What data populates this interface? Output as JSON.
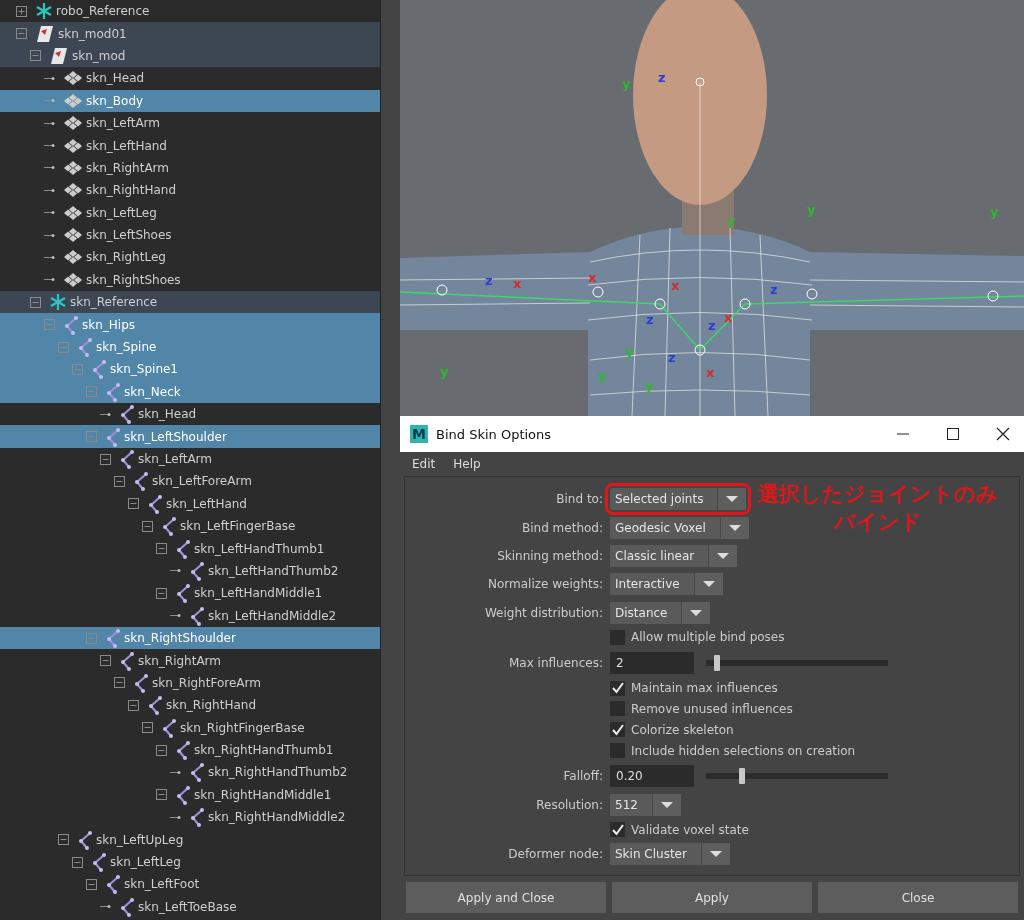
{
  "outliner": {
    "items": [
      {
        "label": "robo_Reference",
        "kind": "reference",
        "selected": false,
        "highlighted": false,
        "expanded": false
      },
      {
        "label": "skn_mod01",
        "kind": "group",
        "selected": false,
        "highlighted": true,
        "expanded": true,
        "children": [
          {
            "label": "skn_mod",
            "kind": "group",
            "selected": false,
            "highlighted": true,
            "expanded": true,
            "children": [
              {
                "label": "skn_Head",
                "kind": "mesh",
                "selected": false,
                "highlighted": false
              },
              {
                "label": "skn_Body",
                "kind": "mesh",
                "selected": true
              },
              {
                "label": "skn_LeftArm",
                "kind": "mesh",
                "selected": false,
                "highlighted": false
              },
              {
                "label": "skn_LeftHand",
                "kind": "mesh",
                "selected": false,
                "highlighted": false
              },
              {
                "label": "skn_RightArm",
                "kind": "mesh",
                "selected": false,
                "highlighted": false
              },
              {
                "label": "skn_RightHand",
                "kind": "mesh",
                "selected": false,
                "highlighted": false
              },
              {
                "label": "skn_LeftLeg",
                "kind": "mesh",
                "selected": false,
                "highlighted": false
              },
              {
                "label": "skn_LeftShoes",
                "kind": "mesh",
                "selected": false,
                "highlighted": false
              },
              {
                "label": "skn_RightLeg",
                "kind": "mesh",
                "selected": false,
                "highlighted": false
              },
              {
                "label": "skn_RightShoes",
                "kind": "mesh",
                "selected": false,
                "highlighted": false
              }
            ]
          },
          {
            "label": "skn_Reference",
            "kind": "reference",
            "selected": false,
            "highlighted": true,
            "expanded": true,
            "children": [
              {
                "label": "skn_Hips",
                "kind": "joint",
                "selected": true,
                "expanded": true,
                "children": [
                  {
                    "label": "skn_Spine",
                    "kind": "joint",
                    "selected": true,
                    "expanded": true,
                    "children": [
                      {
                        "label": "skn_Spine1",
                        "kind": "joint",
                        "selected": true,
                        "expanded": true,
                        "children": [
                          {
                            "label": "skn_Neck",
                            "kind": "joint",
                            "selected": true,
                            "expanded": true,
                            "children": [
                              {
                                "label": "skn_Head",
                                "kind": "joint",
                                "selected": false,
                                "highlighted": false
                              }
                            ]
                          },
                          {
                            "label": "skn_LeftShoulder",
                            "kind": "joint",
                            "selected": true,
                            "expanded": true,
                            "children": [
                              {
                                "label": "skn_LeftArm",
                                "kind": "joint",
                                "selected": false,
                                "highlighted": false,
                                "expanded": true,
                                "children": [
                                  {
                                    "label": "skn_LeftForeArm",
                                    "kind": "joint",
                                    "selected": false,
                                    "highlighted": false,
                                    "expanded": true,
                                    "children": [
                                      {
                                        "label": "skn_LeftHand",
                                        "kind": "joint",
                                        "selected": false,
                                        "highlighted": false,
                                        "expanded": true,
                                        "children": [
                                          {
                                            "label": "skn_LeftFingerBase",
                                            "kind": "joint",
                                            "selected": false,
                                            "highlighted": false,
                                            "expanded": true,
                                            "children": [
                                              {
                                                "label": "skn_LeftHandThumb1",
                                                "kind": "joint",
                                                "selected": false,
                                                "highlighted": false,
                                                "expanded": true,
                                                "children": [
                                                  {
                                                    "label": "skn_LeftHandThumb2",
                                                    "kind": "joint",
                                                    "selected": false,
                                                    "highlighted": false
                                                  }
                                                ]
                                              },
                                              {
                                                "label": "skn_LeftHandMiddle1",
                                                "kind": "joint",
                                                "selected": false,
                                                "highlighted": false,
                                                "expanded": true,
                                                "children": [
                                                  {
                                                    "label": "skn_LeftHandMiddle2",
                                                    "kind": "joint",
                                                    "selected": false,
                                                    "highlighted": false
                                                  }
                                                ]
                                              }
                                            ]
                                          }
                                        ]
                                      }
                                    ]
                                  }
                                ]
                              }
                            ]
                          },
                          {
                            "label": "skn_RightShoulder",
                            "kind": "joint",
                            "selected": true,
                            "expanded": true,
                            "children": [
                              {
                                "label": "skn_RightArm",
                                "kind": "joint",
                                "selected": false,
                                "highlighted": false,
                                "expanded": true,
                                "children": [
                                  {
                                    "label": "skn_RightForeArm",
                                    "kind": "joint",
                                    "selected": false,
                                    "highlighted": false,
                                    "expanded": true,
                                    "children": [
                                      {
                                        "label": "skn_RightHand",
                                        "kind": "joint",
                                        "selected": false,
                                        "highlighted": false,
                                        "expanded": true,
                                        "children": [
                                          {
                                            "label": "skn_RightFingerBase",
                                            "kind": "joint",
                                            "selected": false,
                                            "highlighted": false,
                                            "expanded": true,
                                            "children": [
                                              {
                                                "label": "skn_RightHandThumb1",
                                                "kind": "joint",
                                                "selected": false,
                                                "highlighted": false,
                                                "expanded": true,
                                                "children": [
                                                  {
                                                    "label": "skn_RightHandThumb2",
                                                    "kind": "joint",
                                                    "selected": false,
                                                    "highlighted": false
                                                  }
                                                ]
                                              },
                                              {
                                                "label": "skn_RightHandMiddle1",
                                                "kind": "joint",
                                                "selected": false,
                                                "highlighted": false,
                                                "expanded": true,
                                                "children": [
                                                  {
                                                    "label": "skn_RightHandMiddle2",
                                                    "kind": "joint",
                                                    "selected": false,
                                                    "highlighted": false
                                                  }
                                                ]
                                              }
                                            ]
                                          }
                                        ]
                                      }
                                    ]
                                  }
                                ]
                              }
                            ]
                          }
                        ]
                      }
                    ]
                  },
                  {
                    "label": "skn_LeftUpLeg",
                    "kind": "joint",
                    "selected": false,
                    "highlighted": false,
                    "expanded": true,
                    "children": [
                      {
                        "label": "skn_LeftLeg",
                        "kind": "joint",
                        "selected": false,
                        "highlighted": false,
                        "expanded": true,
                        "children": [
                          {
                            "label": "skn_LeftFoot",
                            "kind": "joint",
                            "selected": false,
                            "highlighted": false,
                            "expanded": true,
                            "children": [
                              {
                                "label": "skn_LeftToeBase",
                                "kind": "joint",
                                "selected": false,
                                "highlighted": false
                              }
                            ]
                          }
                        ]
                      }
                    ]
                  }
                ]
              }
            ]
          }
        ]
      }
    ]
  },
  "viewport": {
    "axis_labels": [
      {
        "text": "y",
        "color": "#2fb82f"
      },
      {
        "text": "z",
        "color": "#2b3fd6"
      },
      {
        "text": "y",
        "color": "#2fb82f"
      },
      {
        "text": "y",
        "color": "#2fb82f"
      },
      {
        "text": "y",
        "color": "#2fb82f"
      },
      {
        "text": "z",
        "color": "#2b3fd6"
      },
      {
        "text": "x",
        "color": "#d62b2b"
      },
      {
        "text": "x",
        "color": "#d62b2b"
      },
      {
        "text": "z",
        "color": "#2b3fd6"
      },
      {
        "text": "x",
        "color": "#d62b2b"
      },
      {
        "text": "z",
        "color": "#2b3fd6"
      },
      {
        "text": "x",
        "color": "#d62b2b"
      },
      {
        "text": "z",
        "color": "#2b3fd6"
      },
      {
        "text": "y",
        "color": "#2fb82f"
      },
      {
        "text": "y",
        "color": "#2fb82f"
      },
      {
        "text": "z",
        "color": "#2b3fd6"
      },
      {
        "text": "y",
        "color": "#2fb82f"
      },
      {
        "text": "y",
        "color": "#2fb82f"
      },
      {
        "text": "x",
        "color": "#d62b2b"
      }
    ]
  },
  "dialog": {
    "logo_letter": "M",
    "title": "Bind Skin Options",
    "menu": [
      "Edit",
      "Help"
    ],
    "rows": [
      {
        "kind": "dropdown",
        "label": "Bind to:",
        "value": "Selected joints",
        "annotated": true
      },
      {
        "kind": "dropdown",
        "label": "Bind method:",
        "value": "Geodesic Voxel",
        "annotated": false
      },
      {
        "kind": "dropdown",
        "label": "Skinning method:",
        "value": "Classic linear",
        "annotated": false
      },
      {
        "kind": "dropdown",
        "label": "Normalize weights:",
        "value": "Interactive",
        "annotated": false
      },
      {
        "kind": "dropdown",
        "label": "Weight distribution:",
        "value": "Distance",
        "annotated": false
      },
      {
        "kind": "checkbox",
        "label": "Allow multiple bind poses",
        "checked": false
      },
      {
        "kind": "slider",
        "label": "Max influences:",
        "value": "2",
        "level": 0.06
      },
      {
        "kind": "checkbox",
        "label": "Maintain max influences",
        "checked": true
      },
      {
        "kind": "checkbox",
        "label": "Remove unused influences",
        "checked": false
      },
      {
        "kind": "checkbox",
        "label": "Colorize skeleton",
        "checked": true
      },
      {
        "kind": "checkbox",
        "label": "Include hidden selections on creation",
        "checked": false
      },
      {
        "kind": "slider",
        "label": "Falloff:",
        "value": "0.20",
        "level": 0.2
      },
      {
        "kind": "dropdown",
        "label": "Resolution:",
        "value": "512",
        "annotated": false
      },
      {
        "kind": "checkbox",
        "label": "Validate voxel state",
        "checked": true
      },
      {
        "kind": "dropdown",
        "label": "Deformer node:",
        "value": "Skin Cluster",
        "annotated": false
      }
    ],
    "annotation": [
      "選択したジョイントのみ",
      "バインド"
    ],
    "buttons": [
      "Apply and Close",
      "Apply",
      "Close"
    ]
  }
}
